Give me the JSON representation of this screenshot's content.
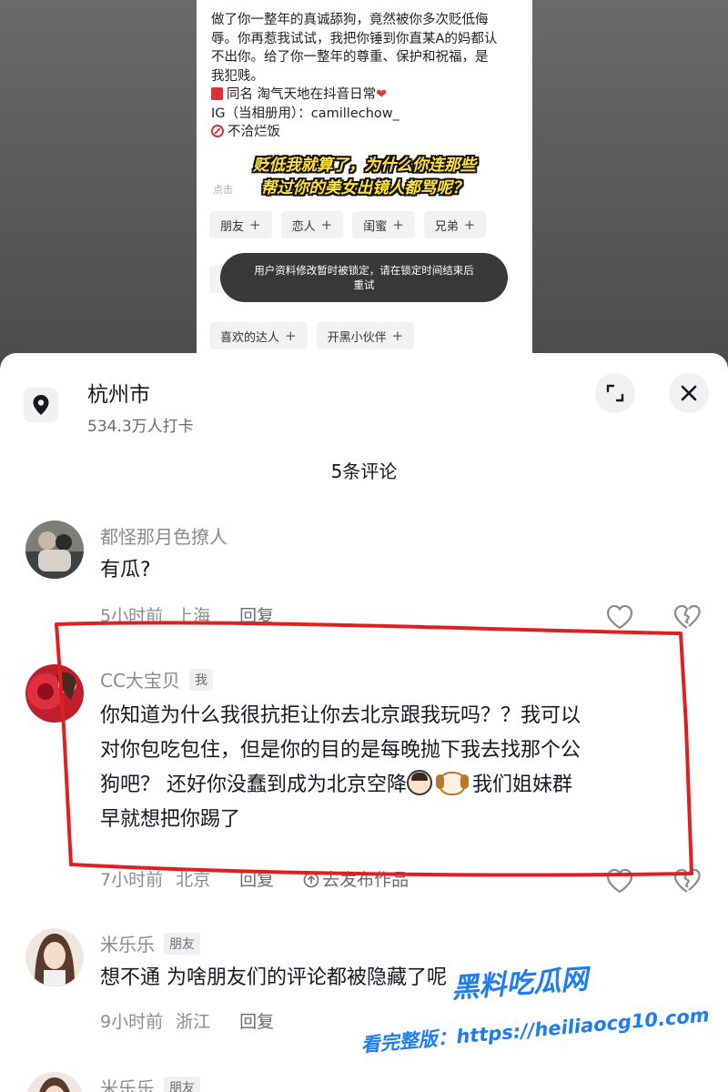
{
  "profile": {
    "bio_lines": [
      "做了你一整年的真诚舔狗，竟然被你多次贬低侮",
      "辱。你再惹我试试，我把你锤到你直某A的妈都认",
      "不出你。给了你一整年的尊重、保护和祝福，是",
      "我犯贱。"
    ],
    "same_name": "同名   淘气天地在抖音日常",
    "ig": "IG（当相册用）：camillechow_",
    "no_spam": "不洽烂饭",
    "hint": "点击",
    "tags_row1": [
      "朋友",
      "恋人",
      "闺蜜",
      "兄弟"
    ],
    "tags_row2": [
      "喜欢的达人",
      "开黑小伙伴"
    ]
  },
  "overlay_caption": {
    "line1": "贬低我就算了，为什么你连那些",
    "line2": "帮过你的美女出镜人都骂呢？"
  },
  "toast": {
    "line1": "用户资料修改暂时被锁定，请在锁定时间结束后",
    "line2": "重试"
  },
  "sheet": {
    "location_title": "杭州市",
    "location_sub": "534.3万人打卡",
    "comment_count": "5条评论"
  },
  "comments": [
    {
      "name": "都怪那月色撩人",
      "text": "有瓜?",
      "time": "5小时前",
      "place": "上海",
      "reply": "回复"
    },
    {
      "name": "CC大宝贝",
      "badge": "我",
      "text_line1": "你知道为什么我很抗拒让你去北京跟我玩吗？？我可以",
      "text_line2": "对你包吃包住，但是你的目的是每晚抛下我去找那个公",
      "text_line3a": "狗吧？  还好你没蠢到成为北京空降",
      "text_line3b": "  我们姐妹群",
      "text_line4": "早就想把你踢了",
      "time": "7小时前",
      "place": "北京",
      "reply": "回复",
      "go_post": "去发布作品"
    },
    {
      "name": "米乐乐",
      "badge": "朋友",
      "text": "想不通  为啥朋友们的评论都被隐藏了呢",
      "time": "9小时前",
      "place": "浙江",
      "reply": "回复"
    },
    {
      "name": "米乐乐",
      "badge": "朋友"
    }
  ],
  "watermark": {
    "brand": "黑料吃瓜网",
    "url": "看完整版：https://heiliaocg10.com"
  },
  "colors": {
    "accent_red": "#e02020",
    "watermark_blue": "#1f7df2",
    "caption_yellow": "#ffe23d"
  }
}
